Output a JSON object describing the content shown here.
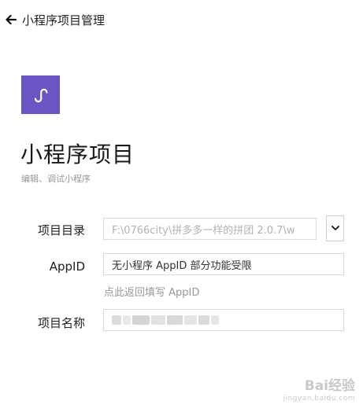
{
  "header": {
    "title": "小程序项目管理",
    "back_icon": "arrow-left-icon"
  },
  "logo": {
    "icon": "miniprogram-logo-icon",
    "bg_color": "#6a55c2"
  },
  "project": {
    "title": "小程序项目",
    "subtitle": "编辑、调试小程序"
  },
  "form": {
    "directory": {
      "label": "项目目录",
      "value": "F:\\0766city\\拼多多一样的拼团 2.0.7\\w"
    },
    "appid": {
      "label": "AppID",
      "value": "无小程序 AppID 部分功能受限",
      "hint": "点此返回填写 AppID"
    },
    "name": {
      "label": "项目名称",
      "value": ""
    }
  },
  "watermark": {
    "main": "Bai经验",
    "sub": "jingyan.baidu.com"
  }
}
